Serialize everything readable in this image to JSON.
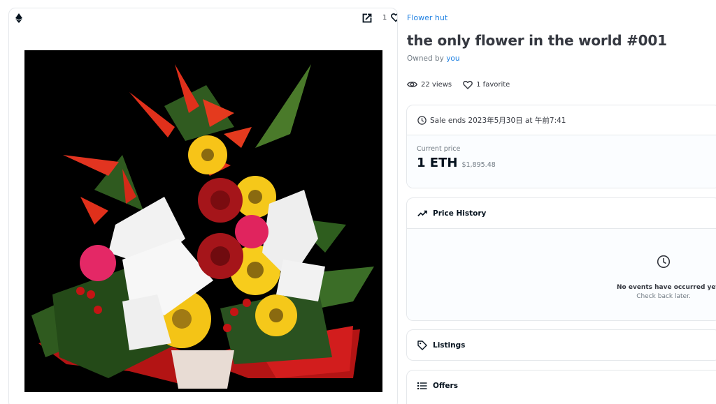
{
  "image_card": {
    "favorite_count": "1",
    "icons": [
      "ethereum-icon",
      "open-external-icon",
      "heart-icon"
    ]
  },
  "collection": {
    "name": "Flower hut"
  },
  "nft": {
    "title": "the only flower in the world #001",
    "owned_by_prefix": "Owned by",
    "owner": "you"
  },
  "stats": {
    "views": "22 views",
    "favorites": "1 favorite"
  },
  "sale": {
    "ends_text": "Sale ends 2023年5月30日 at 午前7:41",
    "current_price_label": "Current price",
    "price_eth": "1 ETH",
    "price_usd": "$1,895.48"
  },
  "price_history": {
    "title": "Price History",
    "empty_title": "No events have occurred yet",
    "empty_subtitle": "Check back later."
  },
  "listings": {
    "title": "Listings"
  },
  "offers": {
    "title": "Offers"
  },
  "colors": {
    "accent_blue": "#2081e2",
    "text_dark": "#04111d",
    "text_muted": "#707a83",
    "border": "#e5e8eb"
  }
}
